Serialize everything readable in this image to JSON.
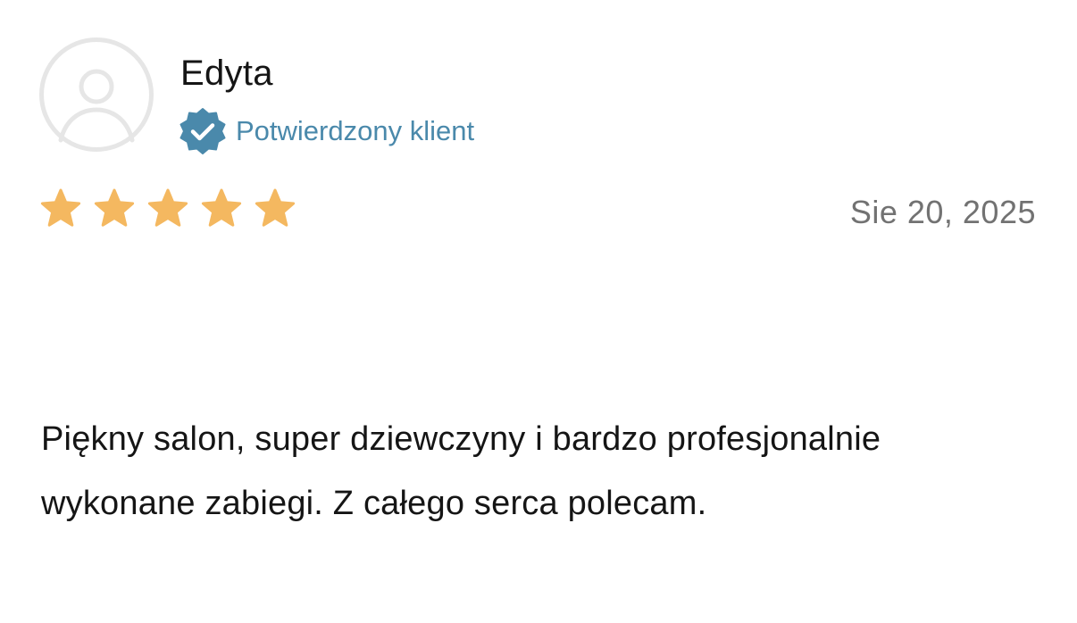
{
  "review": {
    "reviewer_name": "Edyta",
    "verified_label": "Potwierdzony klient",
    "rating": 5,
    "rating_max": 5,
    "date": "Sie 20, 2025",
    "text": "Piękny salon, super dziewczyny i bardzo profesjonalnie wykonane zabiegi. Z całego serca polecam."
  },
  "icons": {
    "avatar": "user-placeholder-icon",
    "verified": "verified-badge-icon",
    "star": "star-icon"
  },
  "colors": {
    "star": "#f4b860",
    "verified_badge": "#4a89ab",
    "verified_text": "#4a89ab",
    "avatar_outline": "#e6e6e6",
    "name_text": "#151515",
    "date_text": "#727272",
    "body_text": "#151515"
  }
}
